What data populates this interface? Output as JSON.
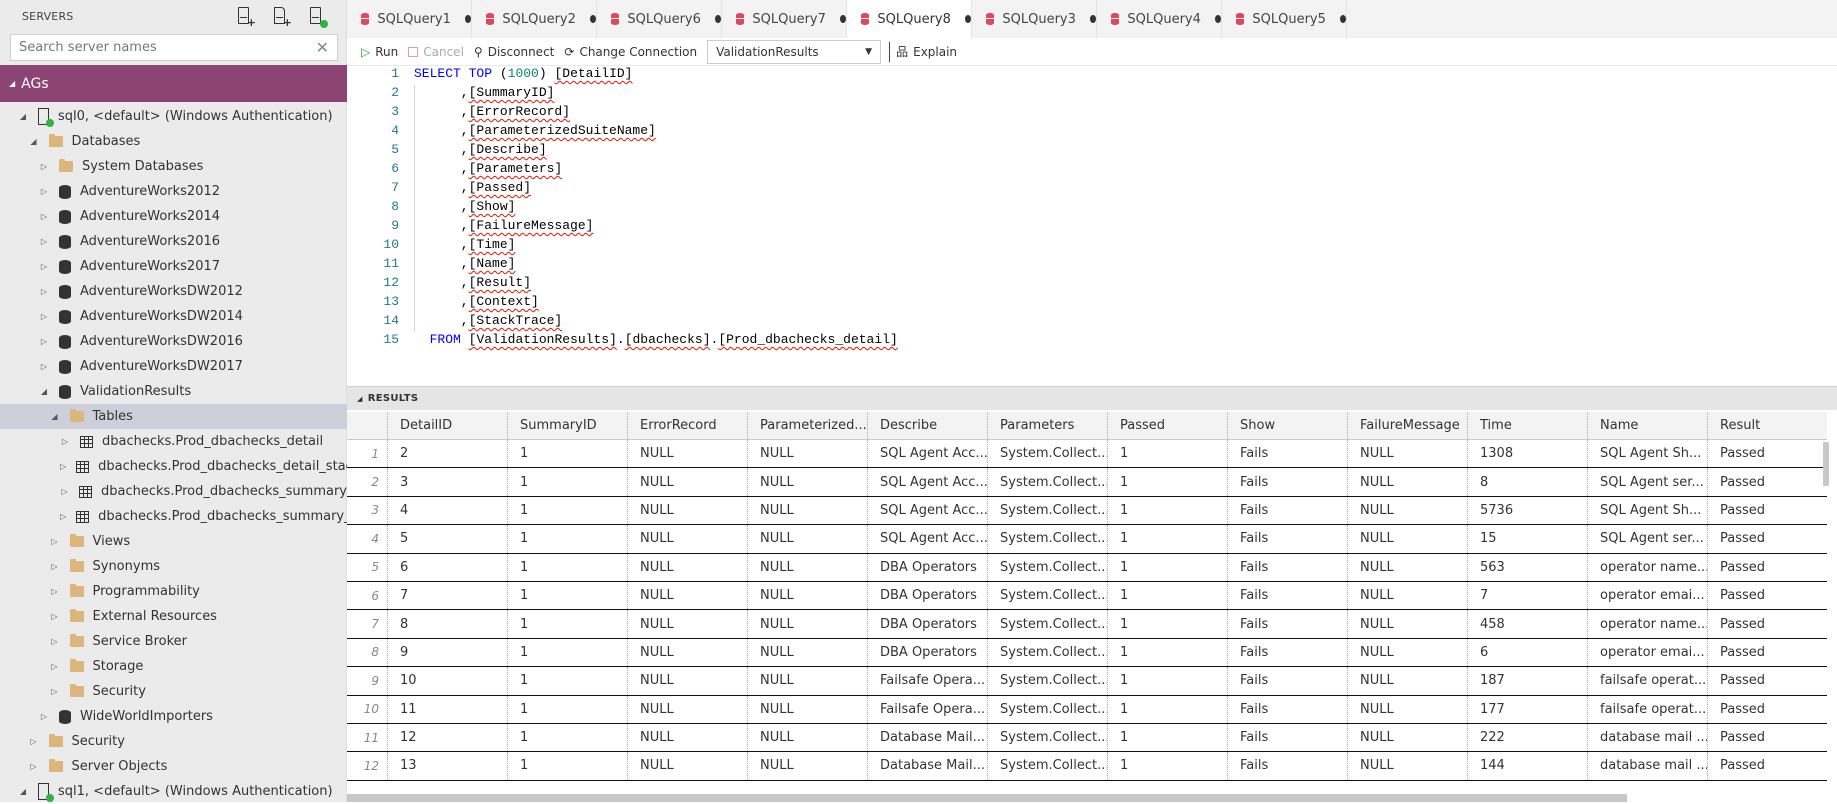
{
  "sidebar": {
    "title": "SERVERS",
    "search_placeholder": "Search server names",
    "group": "AGs",
    "tree": [
      {
        "label": "sql0, <default> (Windows Authentication)",
        "level": 0,
        "icon": "server",
        "expanded": true
      },
      {
        "label": "Databases",
        "level": 1,
        "icon": "folder",
        "expanded": true
      },
      {
        "label": "System Databases",
        "level": 2,
        "icon": "folder",
        "expanded": false
      },
      {
        "label": "AdventureWorks2012",
        "level": 2,
        "icon": "database",
        "expanded": false
      },
      {
        "label": "AdventureWorks2014",
        "level": 2,
        "icon": "database",
        "expanded": false
      },
      {
        "label": "AdventureWorks2016",
        "level": 2,
        "icon": "database",
        "expanded": false
      },
      {
        "label": "AdventureWorks2017",
        "level": 2,
        "icon": "database",
        "expanded": false
      },
      {
        "label": "AdventureWorksDW2012",
        "level": 2,
        "icon": "database",
        "expanded": false
      },
      {
        "label": "AdventureWorksDW2014",
        "level": 2,
        "icon": "database",
        "expanded": false
      },
      {
        "label": "AdventureWorksDW2016",
        "level": 2,
        "icon": "database",
        "expanded": false
      },
      {
        "label": "AdventureWorksDW2017",
        "level": 2,
        "icon": "database",
        "expanded": false
      },
      {
        "label": "ValidationResults",
        "level": 2,
        "icon": "database",
        "expanded": true
      },
      {
        "label": "Tables",
        "level": 3,
        "icon": "folder",
        "expanded": true,
        "selected": true
      },
      {
        "label": "dbachecks.Prod_dbachecks_detail",
        "level": 4,
        "icon": "table",
        "expanded": false
      },
      {
        "label": "dbachecks.Prod_dbachecks_detail_stage",
        "level": 4,
        "icon": "table",
        "expanded": false
      },
      {
        "label": "dbachecks.Prod_dbachecks_summary",
        "level": 4,
        "icon": "table",
        "expanded": false
      },
      {
        "label": "dbachecks.Prod_dbachecks_summary_st...",
        "level": 4,
        "icon": "table",
        "expanded": false
      },
      {
        "label": "Views",
        "level": 3,
        "icon": "folder",
        "expanded": false
      },
      {
        "label": "Synonyms",
        "level": 3,
        "icon": "folder",
        "expanded": false
      },
      {
        "label": "Programmability",
        "level": 3,
        "icon": "folder",
        "expanded": false
      },
      {
        "label": "External Resources",
        "level": 3,
        "icon": "folder",
        "expanded": false
      },
      {
        "label": "Service Broker",
        "level": 3,
        "icon": "folder",
        "expanded": false
      },
      {
        "label": "Storage",
        "level": 3,
        "icon": "folder",
        "expanded": false
      },
      {
        "label": "Security",
        "level": 3,
        "icon": "folder",
        "expanded": false
      },
      {
        "label": "WideWorldImporters",
        "level": 2,
        "icon": "database",
        "expanded": false
      },
      {
        "label": "Security",
        "level": 1,
        "icon": "folder",
        "expanded": false
      },
      {
        "label": "Server Objects",
        "level": 1,
        "icon": "folder",
        "expanded": false
      },
      {
        "label": "sql1, <default> (Windows Authentication)",
        "level": 0,
        "icon": "server",
        "expanded": true
      }
    ]
  },
  "tabs": [
    {
      "label": "SQLQuery1"
    },
    {
      "label": "SQLQuery2"
    },
    {
      "label": "SQLQuery6"
    },
    {
      "label": "SQLQuery7"
    },
    {
      "label": "SQLQuery8",
      "active": true
    },
    {
      "label": "SQLQuery3"
    },
    {
      "label": "SQLQuery4"
    },
    {
      "label": "SQLQuery5"
    }
  ],
  "toolbar": {
    "run": "Run",
    "cancel": "Cancel",
    "disconnect": "Disconnect",
    "change_connection": "Change Connection",
    "database": "ValidationResults",
    "explain": "Explain"
  },
  "editor": {
    "lines": [
      "SELECT TOP (1000) [DetailID]",
      "      ,[SummaryID]",
      "      ,[ErrorRecord]",
      "      ,[ParameterizedSuiteName]",
      "      ,[Describe]",
      "      ,[Parameters]",
      "      ,[Passed]",
      "      ,[Show]",
      "      ,[FailureMessage]",
      "      ,[Time]",
      "      ,[Name]",
      "      ,[Result]",
      "      ,[Context]",
      "      ,[StackTrace]",
      "  FROM [ValidationResults].[dbachecks].[Prod_dbachecks_detail]"
    ]
  },
  "results": {
    "title": "RESULTS",
    "columns": [
      "DetailID",
      "SummaryID",
      "ErrorRecord",
      "Parameterized...",
      "Describe",
      "Parameters",
      "Passed",
      "Show",
      "FailureMessage",
      "Time",
      "Name",
      "Result"
    ],
    "rows": [
      [
        "1",
        "2",
        "1",
        "NULL",
        "NULL",
        "SQL Agent Acc...",
        "System.Collect...",
        "1",
        "Fails",
        "NULL",
        "1308",
        "SQL Agent Sh...",
        "Passed"
      ],
      [
        "2",
        "3",
        "1",
        "NULL",
        "NULL",
        "SQL Agent Acc...",
        "System.Collect...",
        "1",
        "Fails",
        "NULL",
        "8",
        "SQL Agent ser...",
        "Passed"
      ],
      [
        "3",
        "4",
        "1",
        "NULL",
        "NULL",
        "SQL Agent Acc...",
        "System.Collect...",
        "1",
        "Fails",
        "NULL",
        "5736",
        "SQL Agent Sh...",
        "Passed"
      ],
      [
        "4",
        "5",
        "1",
        "NULL",
        "NULL",
        "SQL Agent Acc...",
        "System.Collect...",
        "1",
        "Fails",
        "NULL",
        "15",
        "SQL Agent ser...",
        "Passed"
      ],
      [
        "5",
        "6",
        "1",
        "NULL",
        "NULL",
        "DBA Operators",
        "System.Collect...",
        "1",
        "Fails",
        "NULL",
        "563",
        "operator name...",
        "Passed"
      ],
      [
        "6",
        "7",
        "1",
        "NULL",
        "NULL",
        "DBA Operators",
        "System.Collect...",
        "1",
        "Fails",
        "NULL",
        "7",
        "operator emai...",
        "Passed"
      ],
      [
        "7",
        "8",
        "1",
        "NULL",
        "NULL",
        "DBA Operators",
        "System.Collect...",
        "1",
        "Fails",
        "NULL",
        "458",
        "operator name...",
        "Passed"
      ],
      [
        "8",
        "9",
        "1",
        "NULL",
        "NULL",
        "DBA Operators",
        "System.Collect...",
        "1",
        "Fails",
        "NULL",
        "6",
        "operator emai...",
        "Passed"
      ],
      [
        "9",
        "10",
        "1",
        "NULL",
        "NULL",
        "Failsafe Opera...",
        "System.Collect...",
        "1",
        "Fails",
        "NULL",
        "187",
        "failsafe operat...",
        "Passed"
      ],
      [
        "10",
        "11",
        "1",
        "NULL",
        "NULL",
        "Failsafe Opera...",
        "System.Collect...",
        "1",
        "Fails",
        "NULL",
        "177",
        "failsafe operat...",
        "Passed"
      ],
      [
        "11",
        "12",
        "1",
        "NULL",
        "NULL",
        "Database Mail...",
        "System.Collect...",
        "1",
        "Fails",
        "NULL",
        "222",
        "database mail ...",
        "Passed"
      ],
      [
        "12",
        "13",
        "1",
        "NULL",
        "NULL",
        "Database Mail...",
        "System.Collect...",
        "1",
        "Fails",
        "NULL",
        "144",
        "database mail ...",
        "Passed"
      ]
    ]
  },
  "colors": {
    "accent": "#8c4474",
    "tab_icon": "#e0475d",
    "connected": "#2eb33e",
    "keyword": "#0000ff",
    "number": "#09885a",
    "line_number": "#237893"
  }
}
